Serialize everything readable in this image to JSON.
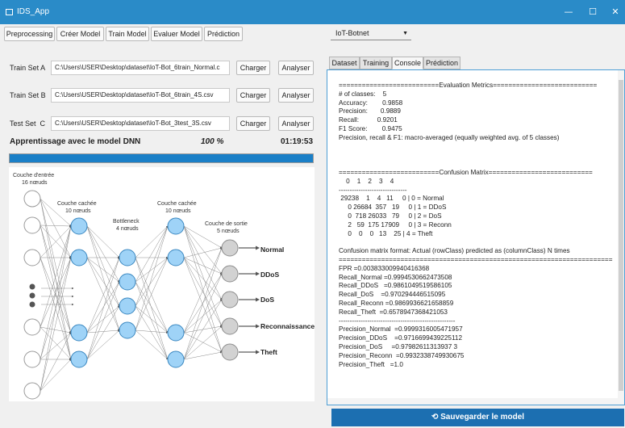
{
  "window": {
    "title": "IDS_App",
    "minimize": "—",
    "maximize": "☐",
    "close": "✕"
  },
  "toolbar": [
    "Preprocessing",
    "Créer Model",
    "Train Model",
    "Evaluer Model",
    "Prédiction"
  ],
  "dataset_select": {
    "value": "IoT-Botnet"
  },
  "sets": [
    {
      "label": "Train Set A",
      "path": "C:\\Users\\USER\\Desktop\\dataset\\IoT-Bot_6train_Normal.c",
      "load": "Charger",
      "analyze": "Analyser"
    },
    {
      "label": "Train Set B",
      "path": "C:\\Users\\USER\\Desktop\\dataset\\IoT-Bot_6train_4S.csv",
      "load": "Charger",
      "analyze": "Analyser"
    },
    {
      "label": "Test Set  C",
      "path": "C:\\Users\\USER\\Desktop\\dataset\\IoT-Bot_3test_3S.csv",
      "load": "Charger",
      "analyze": "Analyser"
    }
  ],
  "training": {
    "label": "Apprentissage avec le model DNN",
    "percent": "100 %",
    "time": "01:19:53",
    "progress": 1.0
  },
  "diagram": {
    "input": "Couche d'entrée",
    "input_n": "16 nœuds",
    "hidden1": "Couche cachée",
    "hidden1_n": "10 nœuds",
    "bottleneck": "Bottleneck",
    "bottleneck_n": "4 nœuds",
    "hidden2": "Couche cachée",
    "hidden2_n": "10 nœuds",
    "output": "Couche de sortie",
    "output_n": "5 nœuds",
    "classes": [
      "Normal",
      "DDoS",
      "DoS",
      "Reconnaissance",
      "Theft"
    ]
  },
  "tabs": [
    "Dataset",
    "Training",
    "Console",
    "Prédiction"
  ],
  "active_tab": "Console",
  "console_text": "==========================Evaluation Metrics===========================\n# of classes:    5\nAccuracy:        0.9858\nPrecision:       0.9889\nRecall:          0.9201\nF1 Score:        0.9475\nPrecision, recall & F1: macro-averaged (equally weighted avg. of 5 classes)\n\n\n\n==========================Confusion Matrix===========================\n    0    1    2    3    4\n-------------------------------\n 29238    1    4   11     0 | 0 = Normal\n     0 26684  357   19     0 | 1 = DDoS\n     0  718 26033   79     0 | 2 = DoS\n     2   59  175 17909     0 | 3 = Reconn\n     0    0    0   13    25 | 4 = Theft\n\nConfusion matrix format: Actual (rowClass) predicted as (columnClass) N times\n=======================================================================\nFPR =0.003833009940416368\nRecall_Normal =0.9994530662473508\nRecall_DDoS   =0.9861049519586105\nRecall_DoS    =0.970294446515095\nRecall_Reconn =0.9869936621658859\nRecall_Theft  =0.6578947368421053\n-----------------------------------------------------\nPrecision_Normal  =0.9999316005471957\nPrecision_DDoS    =0.9716699439225112\nPrecision_DoS     =0.97982611313937 3\nPrecision_Reconn  =0.9932338749930675\nPrecision_Theft   =1.0",
  "save_label": "Sauvegarder le model"
}
